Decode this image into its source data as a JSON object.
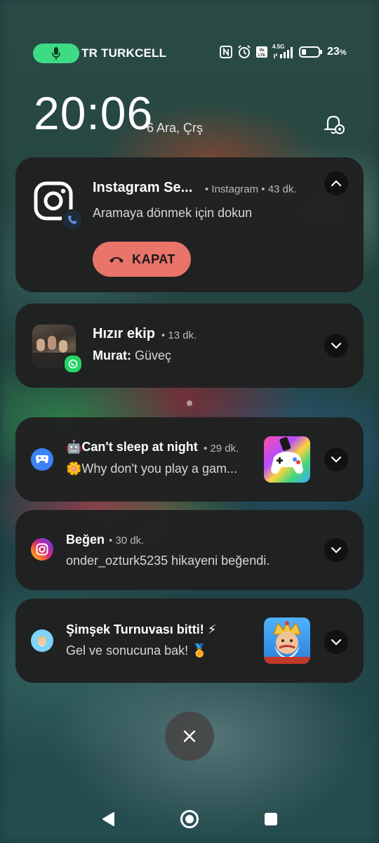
{
  "status_bar": {
    "carrier": "TR TURKCELL",
    "battery_percent": "23",
    "battery_unit": "%",
    "battery_level": 0.23,
    "network_label": "4.5G",
    "icons": [
      "mic-icon",
      "nfc-icon",
      "alarm-icon",
      "volte-icon",
      "signal-icon",
      "battery-icon"
    ]
  },
  "lockscreen": {
    "time": "20:06",
    "date": "6 Ara, Çrş"
  },
  "notifications": [
    {
      "title": "Instagram Se...",
      "meta": "• Instagram • 43 dk.",
      "body": "Aramaya dönmek için dokun",
      "action_label": "KAPAT",
      "icon": "instagram-icon",
      "badge": "phone-icon"
    },
    {
      "title": "Hızır ekip",
      "meta": "• 13 dk.",
      "sender": "Murat:",
      "body": "Güveç",
      "icon": "group-photo",
      "badge": "whatsapp-icon"
    },
    {
      "title": "🤖Can't sleep at night",
      "meta": "• 29 dk.",
      "body": "🌼Why don't you play a gam...",
      "icon": "gamepad-app-icon"
    },
    {
      "title": "Beğen",
      "meta": "• 30 dk.",
      "body": "onder_ozturk5235 hikayeni beğendi.",
      "icon": "instagram-icon"
    },
    {
      "title": "Şimşek Turnuvası bitti! ⚡",
      "meta": "",
      "body": "Gel ve sonucuna bak! 🏅",
      "icon": "royal-match-icon"
    }
  ],
  "colors": {
    "card_bg": "#202020",
    "kapat_bg": "#e8746a",
    "mic_pill": "#3ddc84"
  }
}
